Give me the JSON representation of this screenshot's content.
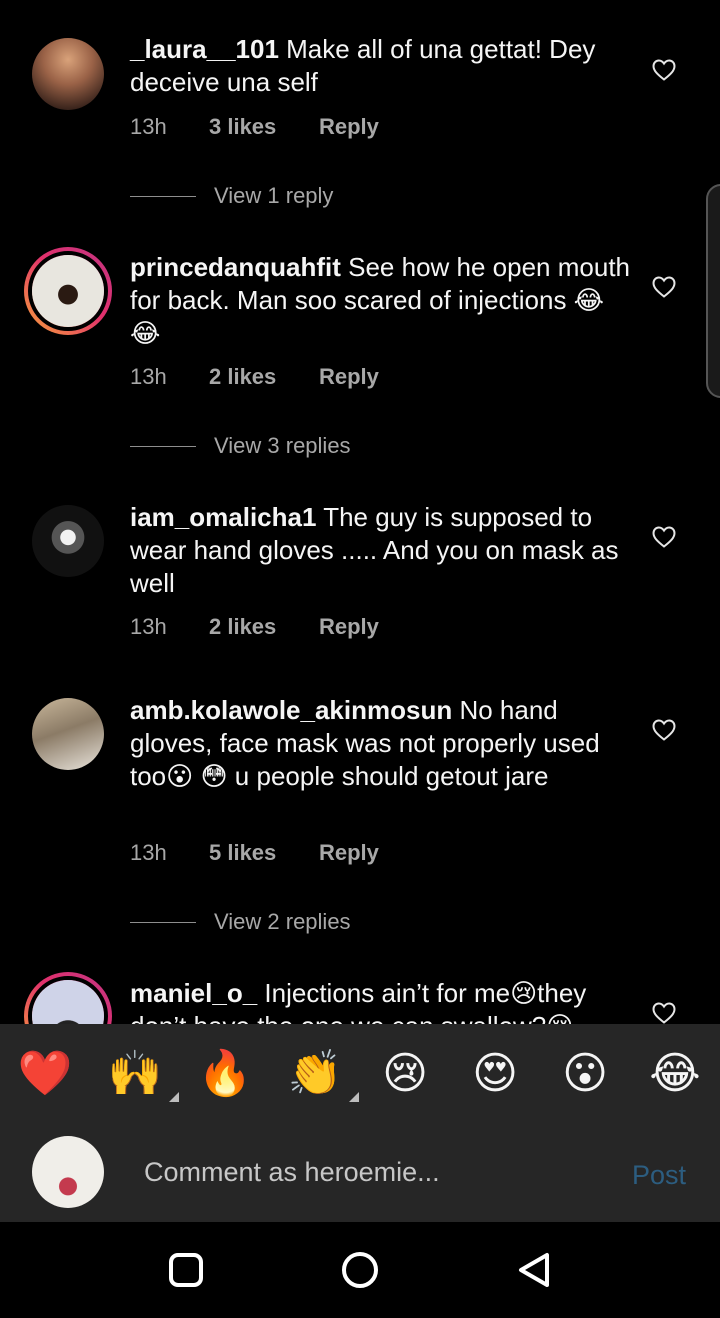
{
  "comments": [
    {
      "username": "_laura__101",
      "text": " Make all of una gettat! Dey deceive una self",
      "time": "13h",
      "likes": "3 likes",
      "reply": "Reply",
      "view_replies": "View 1 reply"
    },
    {
      "username": "princedanquahfit",
      "text": " See how he open mouth for back. Man soo scared of injections 😂😂",
      "time": "13h",
      "likes": "2 likes",
      "reply": "Reply",
      "view_replies": "View 3 replies"
    },
    {
      "username": "iam_omalicha1",
      "text": " The guy is supposed to wear hand gloves ..... And you on mask as well",
      "time": "13h",
      "likes": "2 likes",
      "reply": "Reply"
    },
    {
      "username": "amb.kolawole_akinmosun",
      "text": " No hand gloves, face mask was not properly used too😮 😳 u people should getout jare",
      "time": "13h",
      "likes": "5 likes",
      "reply": "Reply",
      "view_replies": "View 2 replies"
    },
    {
      "username": "maniel_o_",
      "text": " Injections ain’t for me😢they don’t have the one we can swallow?😢"
    }
  ],
  "emoji_bar": {
    "emojis": [
      "❤️",
      "🙌",
      "🔥",
      "👏",
      "😢",
      "😍",
      "😮",
      "😂"
    ]
  },
  "composer": {
    "placeholder": "Comment as heroemie...",
    "post_label": "Post"
  },
  "icons": {
    "heart": "heart-outline-icon",
    "nav_recents": "square-icon",
    "nav_home": "circle-icon",
    "nav_back": "triangle-back-icon"
  },
  "colors": {
    "background": "#000000",
    "panel": "#262626",
    "meta_text": "#a8a8a8",
    "post_button": "#2c5d80"
  }
}
